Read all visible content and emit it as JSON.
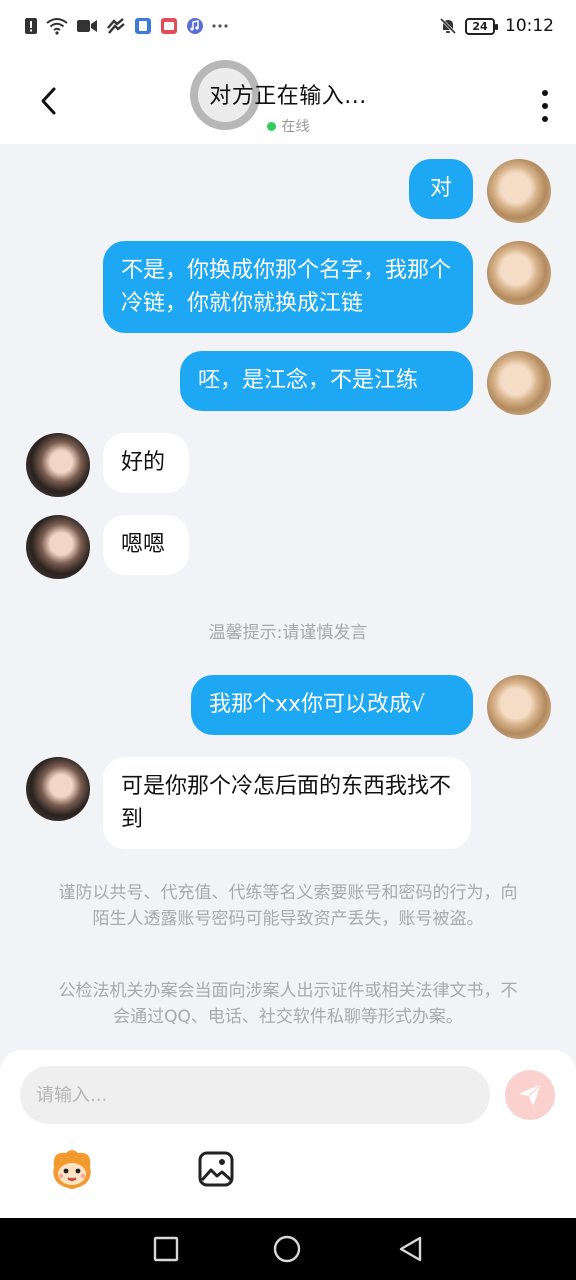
{
  "status_bar": {
    "time": "10:12",
    "battery": "24",
    "left_icons": [
      "alert-icon",
      "wifi-icon",
      "video-icon",
      "link-icon",
      "app-icon-blue",
      "app-icon-red",
      "music-icon",
      "more-dots-icon"
    ],
    "right_icons": [
      "mute-bell-icon",
      "battery-icon"
    ]
  },
  "header": {
    "title": "对方正在输入...",
    "status": "在线",
    "status_color": "#2ed05b"
  },
  "messages": [
    {
      "side": "out",
      "text": "对"
    },
    {
      "side": "out",
      "text": "不是，你换成你那个名字，我那个冷链，你就你就换成江链"
    },
    {
      "side": "out",
      "text": "呸，是江念，不是江练"
    },
    {
      "side": "in",
      "text": "好的"
    },
    {
      "side": "in",
      "text": "嗯嗯"
    },
    {
      "side": "out",
      "text": "我那个xx你可以改成√"
    },
    {
      "side": "in",
      "text": "可是你那个冷怎后面的东西我找不到"
    }
  ],
  "notice": "温馨提示:请谨慎发言",
  "warnings": [
    "谨防以共号、代充值、代练等名义索要账号和密码的行为，向陌生人透露账号密码可能导致资产丢失，账号被盗。",
    "公检法机关办案会当面向涉案人出示证件或相关法律文书，不会通过QQ、电话、社交软件私聊等形式办案。"
  ],
  "composer": {
    "placeholder": "请输入...",
    "send_color": "#fbd1cf"
  },
  "colors": {
    "bubble_out": "#1ea8f3",
    "bubble_in": "#ffffff",
    "background": "#f2f3f7"
  }
}
